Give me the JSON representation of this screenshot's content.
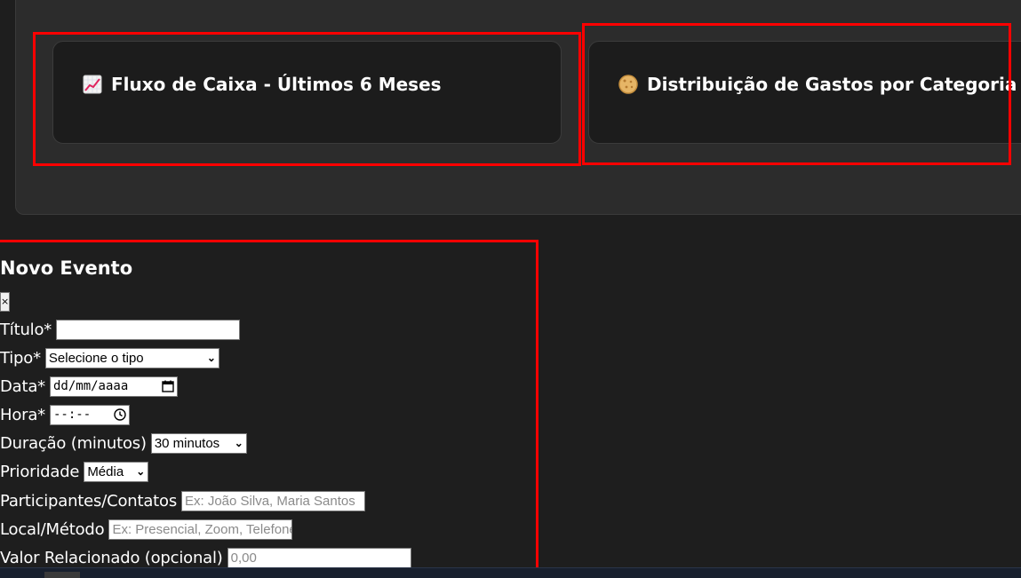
{
  "cards": {
    "cashflow": {
      "icon": "chart-increasing-icon",
      "title": "Fluxo de Caixa - Últimos 6 Meses"
    },
    "spending": {
      "icon": "pie-chart-icon",
      "title": "Distribuição de Gastos por Categoria"
    }
  },
  "modal": {
    "title": "Novo Evento",
    "close_label": "×",
    "fields": {
      "title": {
        "label": "Título*",
        "value": ""
      },
      "type": {
        "label": "Tipo*",
        "selected": "Selecione o tipo"
      },
      "date": {
        "label": "Data*",
        "placeholder": "dd/mm/aaaa"
      },
      "time": {
        "label": "Hora*",
        "placeholder": "--:--"
      },
      "duration": {
        "label": "Duração (minutos)",
        "selected": "30 minutos"
      },
      "priority": {
        "label": "Prioridade",
        "selected": "Média"
      },
      "participants": {
        "label": "Participantes/Contatos",
        "placeholder": "Ex: João Silva, Maria Santos"
      },
      "location": {
        "label": "Local/Método",
        "placeholder": "Ex: Presencial, Zoom, Telefone"
      },
      "value": {
        "label": "Valor Relacionado (opcional)",
        "placeholder": "0,00"
      }
    }
  },
  "colors": {
    "background": "#1e1e1e",
    "panel": "#2c2c2c",
    "card": "#1c1c1c",
    "highlight": "#ff0000",
    "text": "#ffffff"
  }
}
